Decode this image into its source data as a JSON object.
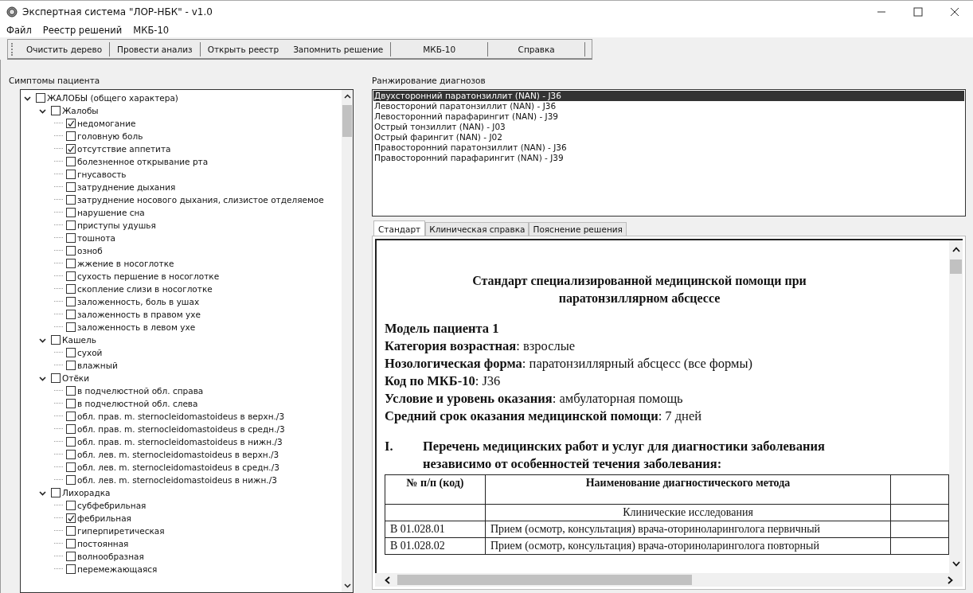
{
  "window": {
    "title": "Экспертная система \"ЛОР-НБК\" - v1.0"
  },
  "menu": [
    "Файл",
    "Реестр решений",
    "МКБ-10"
  ],
  "toolbar": [
    "Очистить дерево",
    "Провести анализ",
    "Открыть реестр",
    "Запомнить решение",
    "МКБ-10",
    "Справка"
  ],
  "symptoms": {
    "label": "Симптомы пациента",
    "tree": [
      {
        "label": "ЖАЛОБЫ (общего характера)",
        "checked": false,
        "expanded": true,
        "children": [
          {
            "label": "Жалобы",
            "checked": false,
            "expanded": true,
            "children": [
              {
                "label": "недомогание",
                "checked": true
              },
              {
                "label": "головную боль",
                "checked": false
              },
              {
                "label": "отсутствие аппетита",
                "checked": true
              },
              {
                "label": "болезненное открывание рта",
                "checked": false
              },
              {
                "label": "гнусавость",
                "checked": false
              },
              {
                "label": "затруднение дыхания",
                "checked": false
              },
              {
                "label": "затруднение носового дыхания, слизистое отделяемое",
                "checked": false
              },
              {
                "label": "нарушение сна",
                "checked": false
              },
              {
                "label": "приступы удушья",
                "checked": false
              },
              {
                "label": "тошнота",
                "checked": false
              },
              {
                "label": "озноб",
                "checked": false
              },
              {
                "label": "жжение в носоглотке",
                "checked": false
              },
              {
                "label": "сухость першение в носоглотке",
                "checked": false
              },
              {
                "label": "скопление слизи в носоглотке",
                "checked": false
              },
              {
                "label": "заложенность, боль в ушах",
                "checked": false
              },
              {
                "label": "заложенность в правом ухе",
                "checked": false
              },
              {
                "label": "заложенность в левом ухе",
                "checked": false
              }
            ]
          },
          {
            "label": "Кашель",
            "checked": false,
            "expanded": true,
            "children": [
              {
                "label": "сухой",
                "checked": false
              },
              {
                "label": "влажный",
                "checked": false
              }
            ]
          },
          {
            "label": "Отёки",
            "checked": false,
            "expanded": true,
            "children": [
              {
                "label": "в подчелюстной обл. справа",
                "checked": false
              },
              {
                "label": "в подчелюстной обл. слева",
                "checked": false
              },
              {
                "label": "обл. прав. m. sternocleidomastoideus в верхн./3",
                "checked": false
              },
              {
                "label": "обл. прав. m. sternocleidomastoideus в средн./3",
                "checked": false
              },
              {
                "label": "обл. прав. m. sternocleidomastoideus в нижн./3",
                "checked": false
              },
              {
                "label": "обл. лев. m. sternocleidomastoideus в верхн./3",
                "checked": false
              },
              {
                "label": "обл. лев. m. sternocleidomastoideus в средн./3",
                "checked": false
              },
              {
                "label": "обл. лев. m. sternocleidomastoideus в нижн./3",
                "checked": false
              }
            ]
          },
          {
            "label": "Лихорадка",
            "checked": false,
            "expanded": true,
            "children": [
              {
                "label": "субфебрильная",
                "checked": false
              },
              {
                "label": "фебрильная",
                "checked": true
              },
              {
                "label": "гиперпиретическая",
                "checked": false
              },
              {
                "label": "постоянная",
                "checked": false
              },
              {
                "label": "волнообразная",
                "checked": false
              },
              {
                "label": "перемежающаяся",
                "checked": false
              }
            ]
          }
        ]
      }
    ]
  },
  "diagnoses": {
    "label": "Ранжирование диагнозов",
    "items": [
      {
        "text": "Двухсторонний паратонзиллит (NAN) - J36",
        "selected": true
      },
      {
        "text": "Левостороний паратонзиллит (NAN) - J36",
        "selected": false
      },
      {
        "text": "Левосторонний парафарингит (NAN) - J39",
        "selected": false
      },
      {
        "text": "Острый тонзиллит (NAN) - J03",
        "selected": false
      },
      {
        "text": "Острый фарингит (NAN) - J02",
        "selected": false
      },
      {
        "text": "Правосторонний паратонзиллит (NAN) - J36",
        "selected": false
      },
      {
        "text": "Правосторонний парафарингит (NAN) - J39",
        "selected": false
      }
    ]
  },
  "tabs": [
    {
      "label": "Стандарт",
      "selected": true
    },
    {
      "label": "Клиническая справка",
      "selected": false
    },
    {
      "label": "Пояснение решения",
      "selected": false
    }
  ],
  "document": {
    "title": "Стандарт специализированной медицинской помощи при паратонзиллярном абсцессе",
    "fields": [
      "**Модель пациента 1**",
      "**Категория возрастная**: взрослые",
      "**Нозологическая форма**: паратонзиллярный абсцесс (все формы)",
      "**Код по МКБ-10**: J36",
      "**Условие и уровень  оказания**: амбулаторная помощь",
      "**Средний срок оказания медицинской помощи**:  7 дней"
    ],
    "section": {
      "number": "I.",
      "title": "Перечень медицинских работ и услуг для диагностики заболевания независимо от особенностей течения заболевания:"
    },
    "table": {
      "columns": [
        "№ п/п (код)",
        "Наименование диагностического метода"
      ],
      "rows": [
        {
          "kind": "subheader",
          "text": "Клинические исследования"
        },
        {
          "kind": "row",
          "code": "В 01.028.01",
          "name": "Прием (осмотр, консультация) врача-оториноларинголога первичный"
        },
        {
          "kind": "row",
          "code": "В 01.028.02",
          "name": "Прием (осмотр, консультация) врача-оториноларинголога повторный"
        }
      ]
    }
  }
}
